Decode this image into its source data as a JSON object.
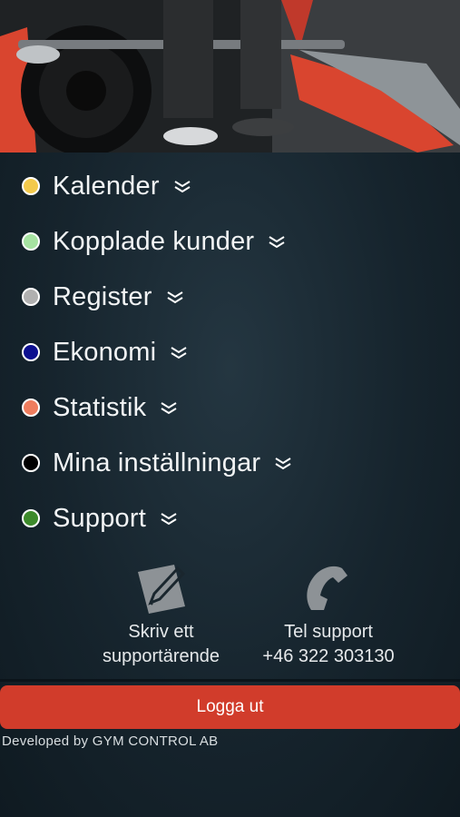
{
  "menu": {
    "items": [
      {
        "label": "Kalender",
        "color": "#f3c94b"
      },
      {
        "label": "Kopplade kunder",
        "color": "#a6e3a1"
      },
      {
        "label": "Register",
        "color": "#b0b0b0"
      },
      {
        "label": "Ekonomi",
        "color": "#0c0f8f"
      },
      {
        "label": "Statistik",
        "color": "#ef7d5e"
      },
      {
        "label": "Mina inställningar",
        "color": "#000000"
      },
      {
        "label": "Support",
        "color": "#3d8a2b"
      }
    ],
    "chevron_icon": "double-chevron-down-icon"
  },
  "support": {
    "ticket": {
      "line1": "Skriv ett",
      "line2": "supportärende",
      "icon": "write-note-icon"
    },
    "phone": {
      "line1": "Tel support",
      "line2": "+46 322 303130",
      "icon": "phone-icon"
    }
  },
  "logout_label": "Logga ut",
  "footer": "Developed by GYM CONTROL AB",
  "colors": {
    "accent": "#d13c2b"
  }
}
